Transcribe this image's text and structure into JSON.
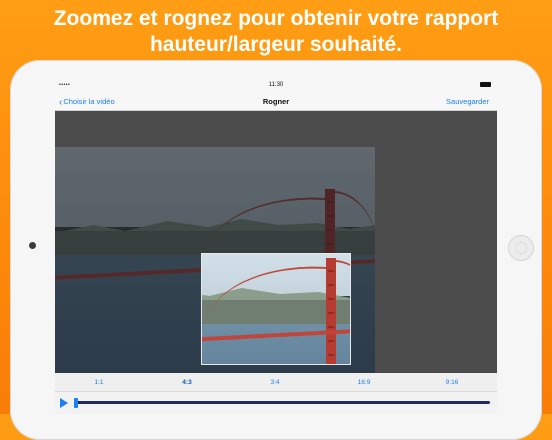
{
  "headline": "Zoomez et rognez pour obtenir votre rapport hauteur/largeur souhaité.",
  "status": {
    "signal": "•••••",
    "time": "11:30"
  },
  "navbar": {
    "back_label": "Choisir la vidéo",
    "title": "Rogner",
    "save_label": "Sauvegarder"
  },
  "ratios": [
    {
      "label": "1:1",
      "active": false
    },
    {
      "label": "4:3",
      "active": true
    },
    {
      "label": "3:4",
      "active": false
    },
    {
      "label": "16:9",
      "active": false
    },
    {
      "label": "9:16",
      "active": false
    }
  ],
  "player": {
    "progress": 0.0
  },
  "colors": {
    "accent": "#1a7ef5",
    "background": "#fd8a0c"
  }
}
